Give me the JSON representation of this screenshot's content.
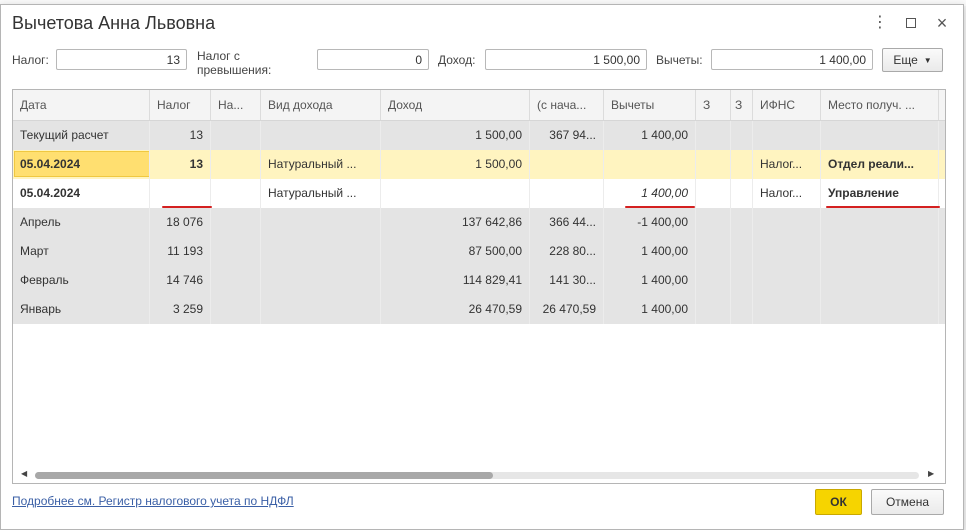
{
  "dialog": {
    "title": "Вычетова Анна Львовна"
  },
  "summary": {
    "tax_label": "Налог:",
    "tax_value": "13",
    "excess_label_line1": "Налог с",
    "excess_label_line2": "превышения:",
    "excess_value": "0",
    "income_label": "Доход:",
    "income_value": "1 500,00",
    "deductions_label": "Вычеты:",
    "deductions_value": "1 400,00",
    "more_label": "Еще"
  },
  "table": {
    "columns": [
      "Дата",
      "Налог",
      "На...",
      "Вид дохода",
      "Доход",
      "(с нача...",
      "Вычеты",
      "З",
      "З",
      "ИФНС",
      "Место получ. ..."
    ],
    "rows": [
      {
        "date": "Текущий расчет",
        "tax": "13",
        "na": "",
        "income_type": "",
        "income": "1 500,00",
        "since_start": "367 94...",
        "deductions": "1 400,00",
        "z1": "",
        "z2": "",
        "ifns": "",
        "place": ""
      },
      {
        "date": "05.04.2024",
        "tax": "13",
        "na": "",
        "income_type": "Натуральный ...",
        "income": "1 500,00",
        "since_start": "",
        "deductions": "",
        "z1": "",
        "z2": "",
        "ifns": "Налог...",
        "place": "Отдел реали..."
      },
      {
        "date": "05.04.2024",
        "tax": "",
        "na": "",
        "income_type": "Натуральный ...",
        "income": "",
        "since_start": "",
        "deductions": "1 400,00",
        "z1": "",
        "z2": "",
        "ifns": "Налог...",
        "place": "Управление"
      },
      {
        "date": "Апрель",
        "tax": "18 076",
        "na": "",
        "income_type": "",
        "income": "137 642,86",
        "since_start": "366 44...",
        "deductions": "-1 400,00",
        "z1": "",
        "z2": "",
        "ifns": "",
        "place": ""
      },
      {
        "date": "Март",
        "tax": "11 193",
        "na": "",
        "income_type": "",
        "income": "87 500,00",
        "since_start": "228 80...",
        "deductions": "1 400,00",
        "z1": "",
        "z2": "",
        "ifns": "",
        "place": ""
      },
      {
        "date": "Февраль",
        "tax": "14 746",
        "na": "",
        "income_type": "",
        "income": "114 829,41",
        "since_start": "141 30...",
        "deductions": "1 400,00",
        "z1": "",
        "z2": "",
        "ifns": "",
        "place": ""
      },
      {
        "date": "Январь",
        "tax": "3 259",
        "na": "",
        "income_type": "",
        "income": "26 470,59",
        "since_start": "26 470,59",
        "deductions": "1 400,00",
        "z1": "",
        "z2": "",
        "ifns": "",
        "place": ""
      }
    ]
  },
  "footer": {
    "register_link": "Подробнее см. Регистр налогового учета по НДФЛ",
    "ok_label": "ОК",
    "cancel_label": "Отмена"
  },
  "colors": {
    "selected_row": "#fff4c0",
    "focused_cell": "#ffdf70",
    "gray_row": "#e4e4e4",
    "ok_button": "#f6d400",
    "annotation_red": "#d42020"
  },
  "icons": {
    "more": "more-vertical-icon",
    "maximize": "maximize-icon",
    "close": "close-icon"
  }
}
